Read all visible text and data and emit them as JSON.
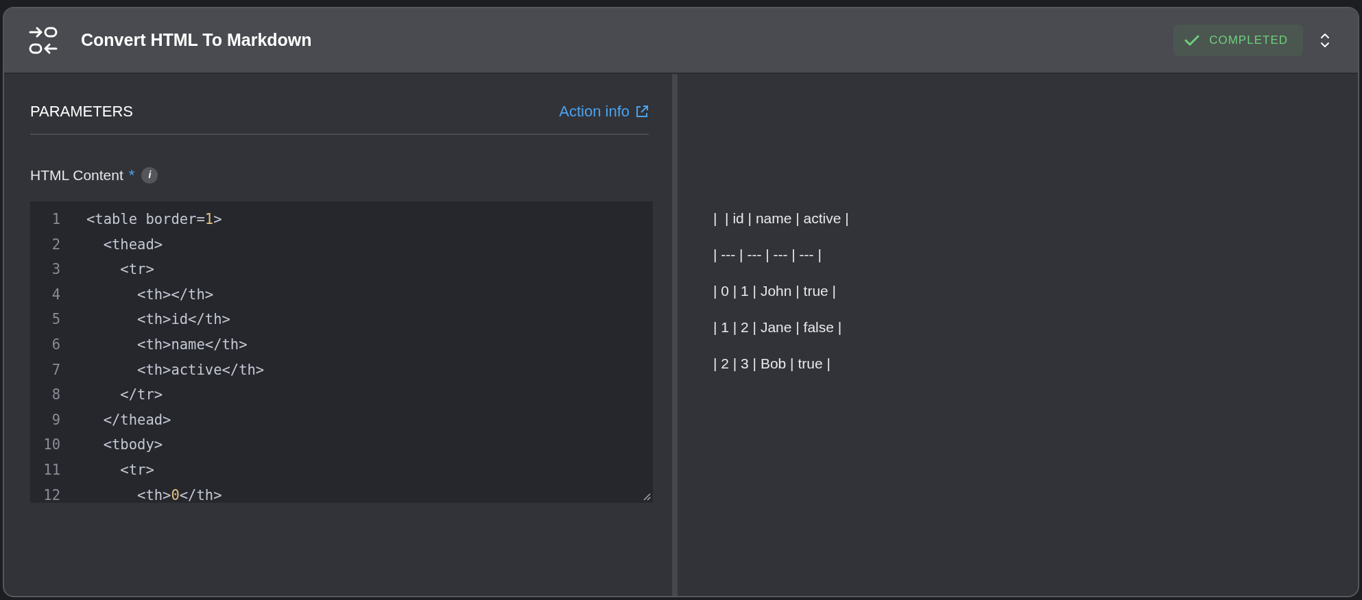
{
  "header": {
    "title": "Convert HTML To Markdown",
    "status": {
      "label": "COMPLETED",
      "kind": "completed"
    }
  },
  "parameters": {
    "heading": "PARAMETERS",
    "link": "Action info",
    "field": {
      "label": "HTML Content",
      "required": true,
      "required_mark": "*",
      "info": "i",
      "code_lines": [
        {
          "number": "1",
          "tokens": [
            {
              "text": "<table border=",
              "kind": "tag"
            },
            {
              "text": "1",
              "kind": "number"
            },
            {
              "text": ">",
              "kind": "tag"
            }
          ]
        },
        {
          "number": "2",
          "tokens": [
            {
              "text": "  <thead>",
              "kind": "tag"
            }
          ]
        },
        {
          "number": "3",
          "tokens": [
            {
              "text": "    <tr>",
              "kind": "tag"
            }
          ]
        },
        {
          "number": "4",
          "tokens": [
            {
              "text": "      <th></th>",
              "kind": "tag"
            }
          ]
        },
        {
          "number": "5",
          "tokens": [
            {
              "text": "      <th>id</th>",
              "kind": "tag"
            }
          ]
        },
        {
          "number": "6",
          "tokens": [
            {
              "text": "      <th>name</th>",
              "kind": "tag"
            }
          ]
        },
        {
          "number": "7",
          "tokens": [
            {
              "text": "      <th>active</th>",
              "kind": "tag"
            }
          ]
        },
        {
          "number": "8",
          "tokens": [
            {
              "text": "    </tr>",
              "kind": "tag"
            }
          ]
        },
        {
          "number": "9",
          "tokens": [
            {
              "text": "  </thead>",
              "kind": "tag"
            }
          ]
        },
        {
          "number": "10",
          "tokens": [
            {
              "text": "  <tbody>",
              "kind": "tag"
            }
          ]
        },
        {
          "number": "11",
          "tokens": [
            {
              "text": "    <tr>",
              "kind": "tag"
            }
          ]
        },
        {
          "number": "12",
          "tokens": [
            {
              "text": "      <th>",
              "kind": "tag"
            },
            {
              "text": "0",
              "kind": "number"
            },
            {
              "text": "</th>",
              "kind": "tag"
            }
          ]
        }
      ]
    }
  },
  "output": {
    "lines": [
      "|  | id | name | active |",
      "| --- | --- | --- | --- |",
      "| 0 | 1 | John | true |",
      "| 1 | 2 | Jane | false |",
      "| 2 | 3 | Bob | true |"
    ]
  }
}
